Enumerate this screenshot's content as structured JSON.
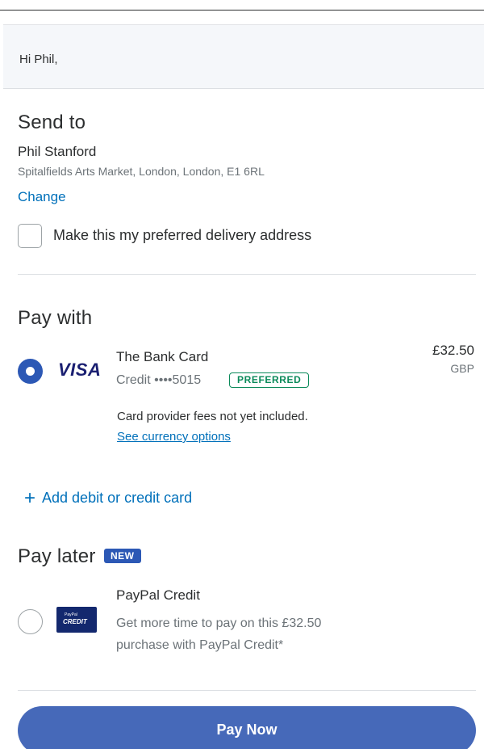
{
  "greeting": "Hi Phil,",
  "send_to": {
    "title": "Send to",
    "name": "Phil Stanford",
    "address": "Spitalfields Arts Market, London, London, E1 6RL",
    "change_label": "Change",
    "preferred_checkbox_label": "Make this my preferred delivery address",
    "preferred_checked": false
  },
  "pay_with": {
    "title": "Pay with",
    "card": {
      "brand": "VISA",
      "name": "The Bank Card",
      "detail": "Credit ••••5015",
      "badge": "PREFERRED",
      "amount": "£32.50",
      "currency": "GBP",
      "selected": true
    },
    "fees_note": "Card provider fees not yet included.",
    "currency_link": "See currency options",
    "add_card_label": "Add debit or credit card"
  },
  "pay_later": {
    "title": "Pay later",
    "badge": "NEW",
    "option": {
      "logo_small": "PayPal",
      "logo_big": "CREDIT",
      "title": "PayPal Credit",
      "description": "Get more time to pay on this £32.50 purchase with PayPal Credit*",
      "selected": false
    }
  },
  "pay_button_label": "Pay Now",
  "colors": {
    "link": "#0070ba",
    "primary_button": "#4669b9",
    "radio_selected": "#2c58b5",
    "preferred_badge": "#0b8a5a",
    "credit_logo_bg": "#13286e"
  }
}
